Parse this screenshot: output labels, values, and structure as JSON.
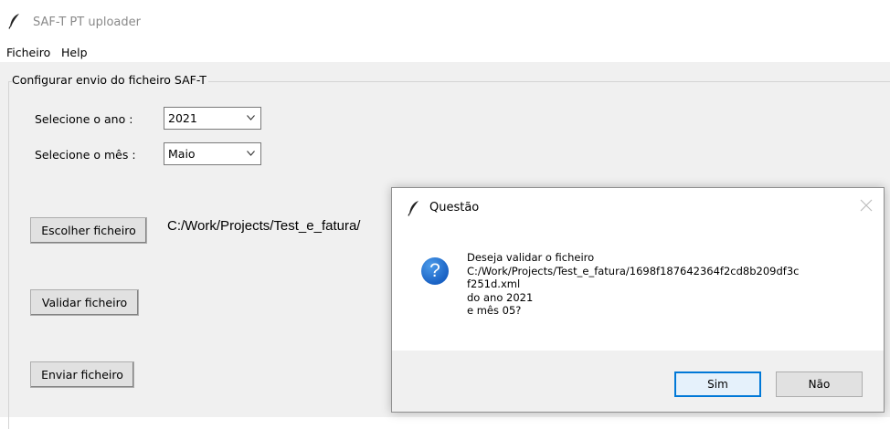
{
  "window": {
    "title": "SAF-T PT uploader",
    "icon": "feather-icon"
  },
  "menu": [
    "Ficheiro",
    "Help"
  ],
  "group": {
    "title": "Configurar envio do ficheiro SAF-T"
  },
  "form": {
    "year_label": "Selecione o ano :",
    "year_value": "2021",
    "month_label": "Selecione o mês :",
    "month_value": "Maio"
  },
  "buttons": {
    "choose_file": "Escolher ficheiro",
    "validate_file": "Validar ficheiro",
    "send_file": "Enviar ficheiro"
  },
  "selected_path": "C:/Work/Projects/Test_e_fatura/",
  "dialog": {
    "title": "Questão",
    "icon": "question-icon",
    "message_lines": [
      "Deseja validar o ficheiro",
      "C:/Work/Projects/Test_e_fatura/1698f187642364f2cd8b209df3c",
      "f251d.xml",
      "do ano 2021",
      "e mês 05?"
    ],
    "yes_label": "Sim",
    "no_label": "Não"
  },
  "colors": {
    "window_bg": "#f0f0f0",
    "accent": "#0078d7",
    "question_icon": "#1a62c4"
  }
}
